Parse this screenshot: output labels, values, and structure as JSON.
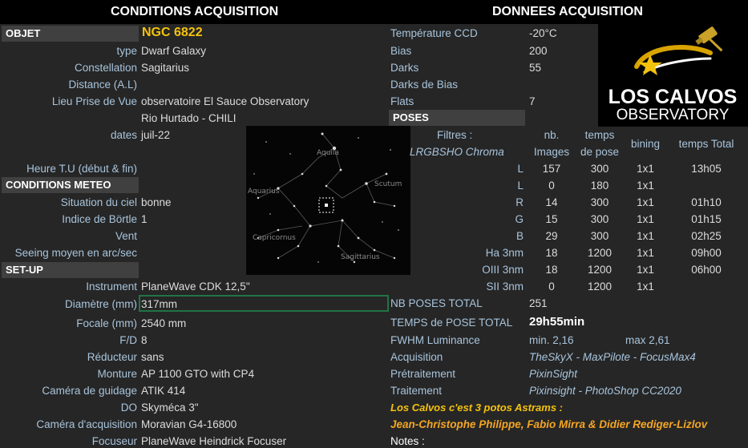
{
  "headers": {
    "left": "CONDITIONS ACQUISITION",
    "right": "DONNEES ACQUISITION"
  },
  "sections": {
    "objet": "OBJET",
    "meteo": "CONDITIONS METEO",
    "setup": "SET-UP",
    "poses": "POSES"
  },
  "objet": {
    "name": "NGC 6822",
    "rows": [
      {
        "label": "type",
        "value": "Dwarf Galaxy"
      },
      {
        "label": "Constellation",
        "value": "Sagitarius"
      },
      {
        "label": "Distance (A.L)",
        "value": ""
      },
      {
        "label": "Lieu Prise de Vue",
        "value": "observatoire El Sauce Observatory"
      },
      {
        "label": "",
        "value": "Rio Hurtado - CHILI"
      },
      {
        "label": "dates",
        "value": "juil-22"
      },
      {
        "label": "Heure T.U (début & fin)",
        "value": ""
      }
    ]
  },
  "meteo": [
    {
      "label": "Situation du ciel",
      "value": "bonne"
    },
    {
      "label": "Indice de Börtle",
      "value": "1"
    },
    {
      "label": "Vent",
      "value": ""
    },
    {
      "label": "Seeing moyen en arc/sec",
      "value": ""
    }
  ],
  "setup": [
    {
      "label": "Instrument",
      "value": "PlaneWave CDK 12,5\""
    },
    {
      "label": "Diamètre (mm)",
      "value": "317mm"
    },
    {
      "label": "Focale (mm)",
      "value": "2540 mm"
    },
    {
      "label": "F/D",
      "value": "8"
    },
    {
      "label": "Réducteur",
      "value": "sans"
    },
    {
      "label": "Monture",
      "value": "AP 1100 GTO with CP4"
    },
    {
      "label": "Caméra de guidage",
      "value": "ATIK 414"
    },
    {
      "label": "DO",
      "value": "Skyméca 3\""
    },
    {
      "label": "Caméra d'acquisition",
      "value": "Moravian G4-16800"
    },
    {
      "label": "Focuseur",
      "value": "PlaneWave Heindrick Focuser"
    }
  ],
  "donnees": [
    {
      "label": "Température CCD",
      "value": "-20°C"
    },
    {
      "label": "Bias",
      "value": "200"
    },
    {
      "label": "Darks",
      "value": "55"
    },
    {
      "label": "Darks de Bias",
      "value": ""
    },
    {
      "label": "Flats",
      "value": "7"
    }
  ],
  "poses_header": {
    "filtres": "Filtres :",
    "filtres_sub": "LRGBSHO Chroma",
    "nb1": "nb.",
    "nb2": "Images",
    "temps1": "temps",
    "temps2": "de pose",
    "bining": "bining",
    "total": "temps Total"
  },
  "poses": [
    {
      "filter": "L",
      "nb": "157",
      "pose": "300",
      "bin": "1x1",
      "total": "13h05"
    },
    {
      "filter": "L",
      "nb": "0",
      "pose": "180",
      "bin": "1x1",
      "total": ""
    },
    {
      "filter": "R",
      "nb": "14",
      "pose": "300",
      "bin": "1x1",
      "total": "01h10"
    },
    {
      "filter": "G",
      "nb": "15",
      "pose": "300",
      "bin": "1x1",
      "total": "01h15"
    },
    {
      "filter": "B",
      "nb": "29",
      "pose": "300",
      "bin": "1x1",
      "total": "02h25"
    },
    {
      "filter": "Ha 3nm",
      "nb": "18",
      "pose": "1200",
      "bin": "1x1",
      "total": "09h00"
    },
    {
      "filter": "OIII 3nm",
      "nb": "18",
      "pose": "1200",
      "bin": "1x1",
      "total": "06h00"
    },
    {
      "filter": "SII 3nm",
      "nb": "0",
      "pose": "1200",
      "bin": "1x1",
      "total": ""
    }
  ],
  "totals": {
    "nb_label": "NB POSES TOTAL",
    "nb_value": "251",
    "temps_label": "TEMPS de POSE TOTAL",
    "temps_value": "29h55min",
    "fwhm_label": "FWHM Luminance",
    "fwhm_min": "min. 2,16",
    "fwhm_max": "max 2,61"
  },
  "software": [
    {
      "label": "Acquisition",
      "value": "TheSkyX - MaxPilote - FocusMax4"
    },
    {
      "label": "Prétraitement",
      "value": "PixinSight"
    },
    {
      "label": "Traitement",
      "value": "Pixinsight - PhotoShop CC2020"
    }
  ],
  "credits": {
    "line1": "Los Calvos c'est 3 potos Astrams :",
    "line2": "Jean-Christophe Philippe, Fabio Mirra & Didier Rediger-Lizlov",
    "notes": "Notes :"
  },
  "map_labels": [
    "Aquila",
    "Scutum",
    "Aquarius",
    "Capricornus",
    "Sagittarius"
  ],
  "logo": {
    "line1": "LOS CALVOS",
    "line2": "OBSERVATORY"
  },
  "colors": {
    "label": "#a8c4dc",
    "accent_yellow": "#f4c20d",
    "credits_gold": "#f5a623",
    "cell_bg": "#262626",
    "section_bg": "#404040",
    "selection": "#217346"
  }
}
